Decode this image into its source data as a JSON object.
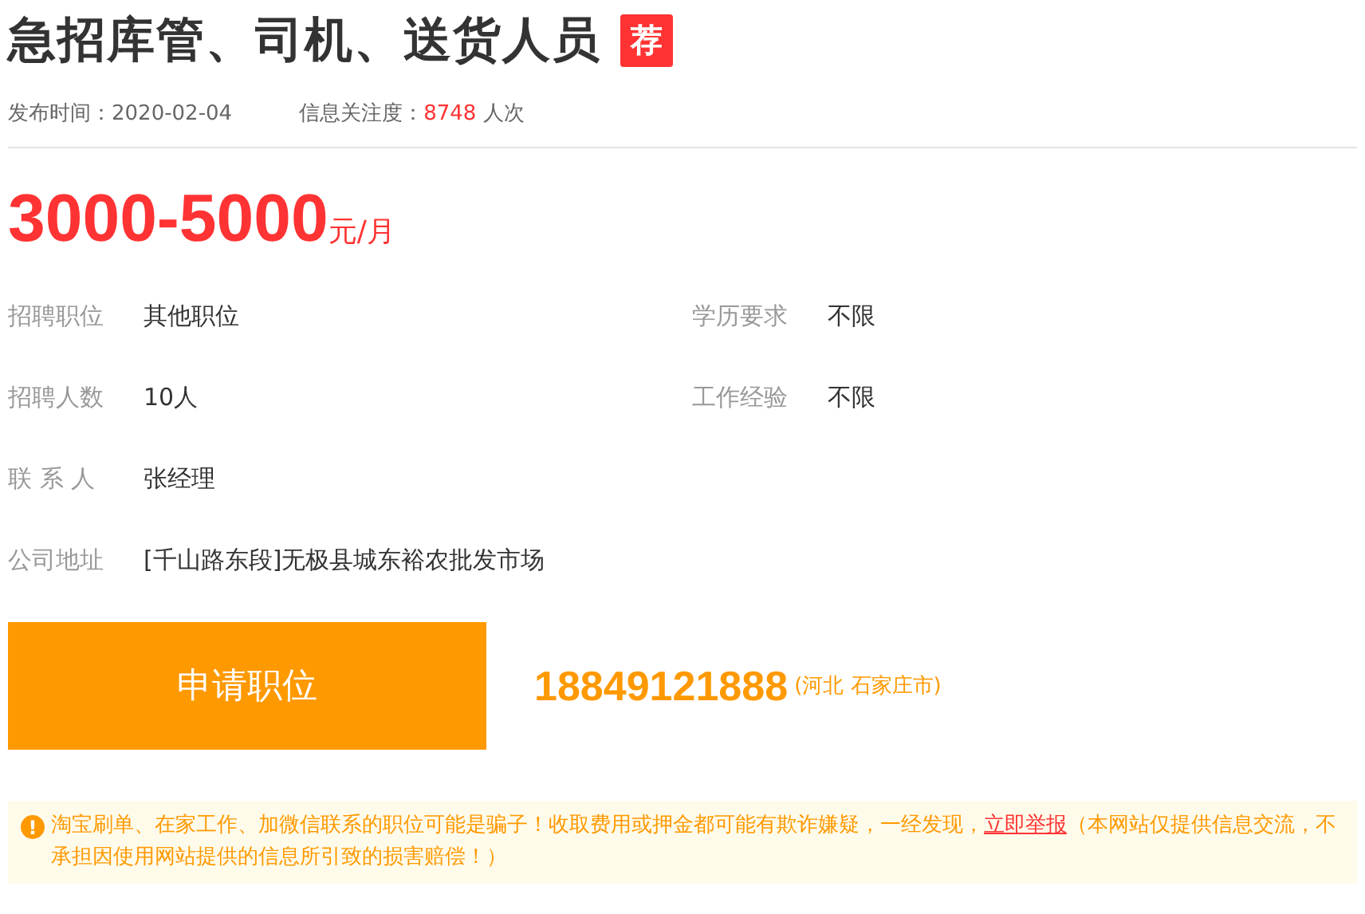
{
  "title": "急招库管、司机、送货人员",
  "badge": "荐",
  "meta": [
    {
      "label": "发布时间：",
      "value": "2020-02-04",
      "highlight": false
    },
    {
      "label": "信息关注度：",
      "value": "8748",
      "suffix": " 人次",
      "highlight": true
    }
  ],
  "salary": {
    "amount": "3000-5000",
    "unit": "元/月"
  },
  "field_rows": [
    [
      {
        "label": "招聘职位",
        "value": "其他职位"
      },
      {
        "label": "学历要求",
        "value": "不限"
      }
    ],
    [
      {
        "label": "招聘人数",
        "value": "10人"
      },
      {
        "label": "工作经验",
        "value": "不限"
      }
    ],
    [
      {
        "label": "联 系 人",
        "value": "张经理"
      }
    ],
    [
      {
        "label": "公司地址",
        "value": "[千山路东段]无极县城东裕农批发市场"
      }
    ]
  ],
  "apply_button": "申请职位",
  "phone": {
    "number": "18849121888",
    "region": "(河北 石家庄市)"
  },
  "notice": {
    "icon": "!",
    "text": "淘宝刷单、在家工作、加微信联系的职位可能是骗子！收取费用或押金都可能有欺诈嫌疑，一经发现，",
    "link": "立即举报",
    "after": "（本网站仅提供信息交流，不承担因使用网站提供的信息所引致的损害赔偿！）"
  }
}
